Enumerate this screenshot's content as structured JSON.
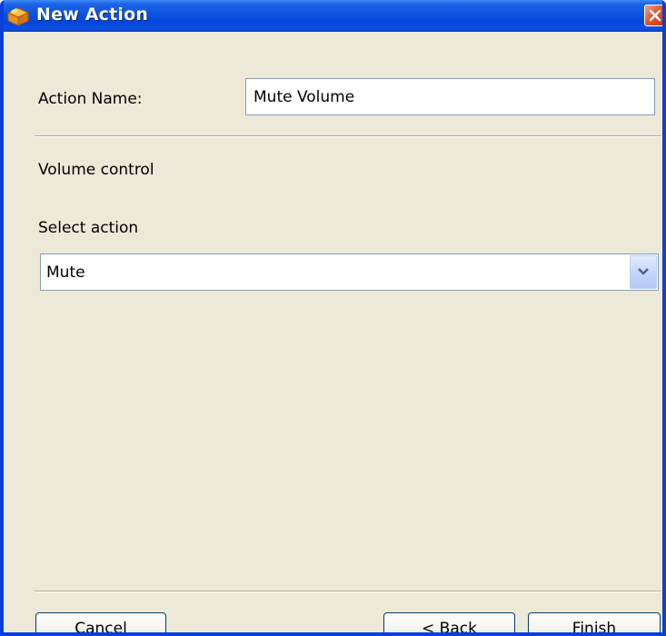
{
  "window": {
    "title": "New Action",
    "icon": "box-icon"
  },
  "form": {
    "action_name_label": "Action Name:",
    "action_name_value": "Mute Volume",
    "section_title": "Volume control",
    "select_label": "Select action",
    "select_value": "Mute"
  },
  "buttons": {
    "cancel": "Cancel",
    "back": "< Back",
    "finish": "Finish"
  },
  "colors": {
    "titlebar": "#0A52E0",
    "dialog_background": "#ECE9D8",
    "close_button": "#E4572E"
  }
}
